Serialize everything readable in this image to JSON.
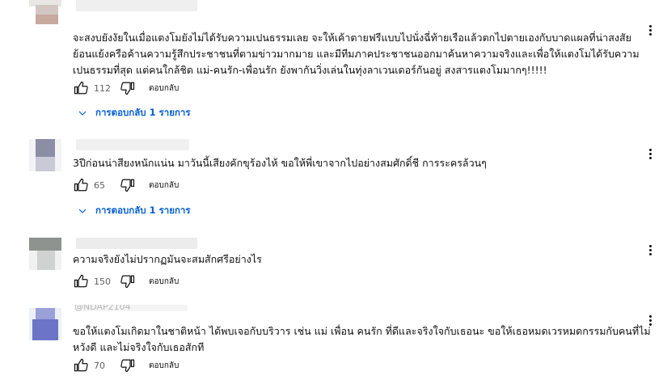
{
  "comments": [
    {
      "author": "",
      "text_lines": [
        "จะสงบยังงัยในเมื่อแตงโมยังไม่ได้รับความเปนธรรมเลย จะให้เค้าตายฟรีแบบไปนั่งฉี่ท้ายเรือแล้วตกไปตายเองกับบาดแผลที่น่าสงสัย",
        "ย้อนแย้งครือค้านความรู้สึกประชาชนที่ตามข่าวมากมาย และมีทีมภาคประชาชนออกมาค้นหาความจริงและเพื่อให้แตงโมได้รับความ",
        "เปนธรรมที่สุด แต่คนใกล้ชิด แม่-คนรัก-เพื่อนรัก ยังพากันวิ่งเล่นในทุ่งลาเวนเดอร์กันอยู่  สงสารแตงโมมากๆ!!!!!"
      ],
      "likes": "112",
      "reply_label": "ตอบกลับ",
      "replies_label": "การตอบกลับ 1 รายการ"
    },
    {
      "author": "",
      "text_lines": [
        "3ปีก่อนน่าสียงหนักแน่น มาวันนี้เสียงคักขุร้องไห้ ขอให้พี่เขาจากไปอย่างสมศักดิ์ชี การระครล้วนๆ"
      ],
      "likes": "65",
      "reply_label": "ตอบกลับ",
      "replies_label": "การตอบกลับ 1 รายการ"
    },
    {
      "author": "",
      "text_lines": [
        "ความจริงยังไม่ปรากฏมันจะสมสักศรีอย่างไร"
      ],
      "likes": "150",
      "reply_label": "ตอบกลับ"
    },
    {
      "author": "@NDAP2104",
      "text_lines": [
        "ขอให้แตงโมเกิดมาในชาติหน้า ได้พบเจอกับบริวาร เช่น แม่ เพื่อน คนรัก ที่ดีและจริงใจกับเธอนะ  ขอให้เธอหมดเวรหมดกรรมกับคนที่ไม่",
        "หวังดี และไม่จริงใจกับเธอสักที"
      ],
      "likes": "70",
      "reply_label": "ตอบกลับ"
    }
  ],
  "colors": {
    "link_blue": "#065fd4",
    "text": "#0f0f0f",
    "meta": "#606060"
  },
  "icons": {
    "like": "thumbs-up-icon",
    "dislike": "thumbs-down-icon",
    "menu": "more-vert-icon",
    "expand": "chevron-down-icon"
  }
}
